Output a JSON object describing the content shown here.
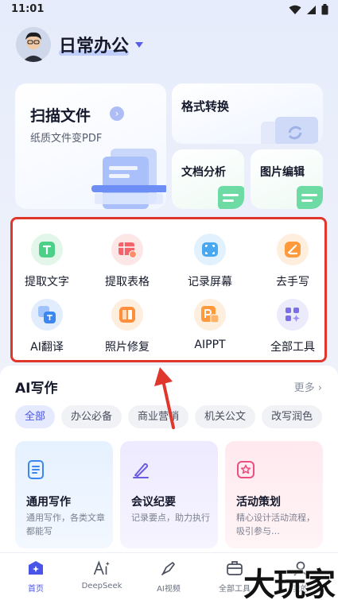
{
  "status_bar": {
    "time": "11:01"
  },
  "header": {
    "title": "日常办公"
  },
  "top_cards": {
    "scan": {
      "title": "扫描文件",
      "subtitle": "纸质文件变PDF"
    },
    "format": {
      "title": "格式转换"
    },
    "doc_analysis": {
      "title": "文档分析"
    },
    "image_edit": {
      "title": "图片编辑"
    }
  },
  "tools": [
    {
      "label": "提取文字",
      "icon": "extract-text-icon"
    },
    {
      "label": "提取表格",
      "icon": "extract-table-icon"
    },
    {
      "label": "记录屏幕",
      "icon": "screen-record-icon"
    },
    {
      "label": "去手写",
      "icon": "remove-handwriting-icon"
    },
    {
      "label": "AI翻译",
      "icon": "ai-translate-icon"
    },
    {
      "label": "照片修复",
      "icon": "photo-repair-icon"
    },
    {
      "label": "AIPPT",
      "icon": "ai-ppt-icon"
    },
    {
      "label": "全部工具",
      "icon": "all-tools-icon"
    }
  ],
  "ai_writing": {
    "title": "AI写作",
    "more": "更多",
    "chips": [
      "全部",
      "办公必备",
      "商业营销",
      "机关公文",
      "改写润色"
    ],
    "cards": [
      {
        "title": "通用写作",
        "desc": "通用写作，各类文章都能写"
      },
      {
        "title": "会议纪要",
        "desc": "记录要点，助力执行"
      },
      {
        "title": "活动策划",
        "desc": "精心设计活动流程，吸引参与…"
      }
    ]
  },
  "bottom_nav": [
    "首页",
    "DeepSeek",
    "AI视频",
    "全部工具",
    "我的"
  ],
  "watermark": "大玩家",
  "colors": {
    "accent": "#4a55e8",
    "highlight_border": "#e0372c"
  }
}
